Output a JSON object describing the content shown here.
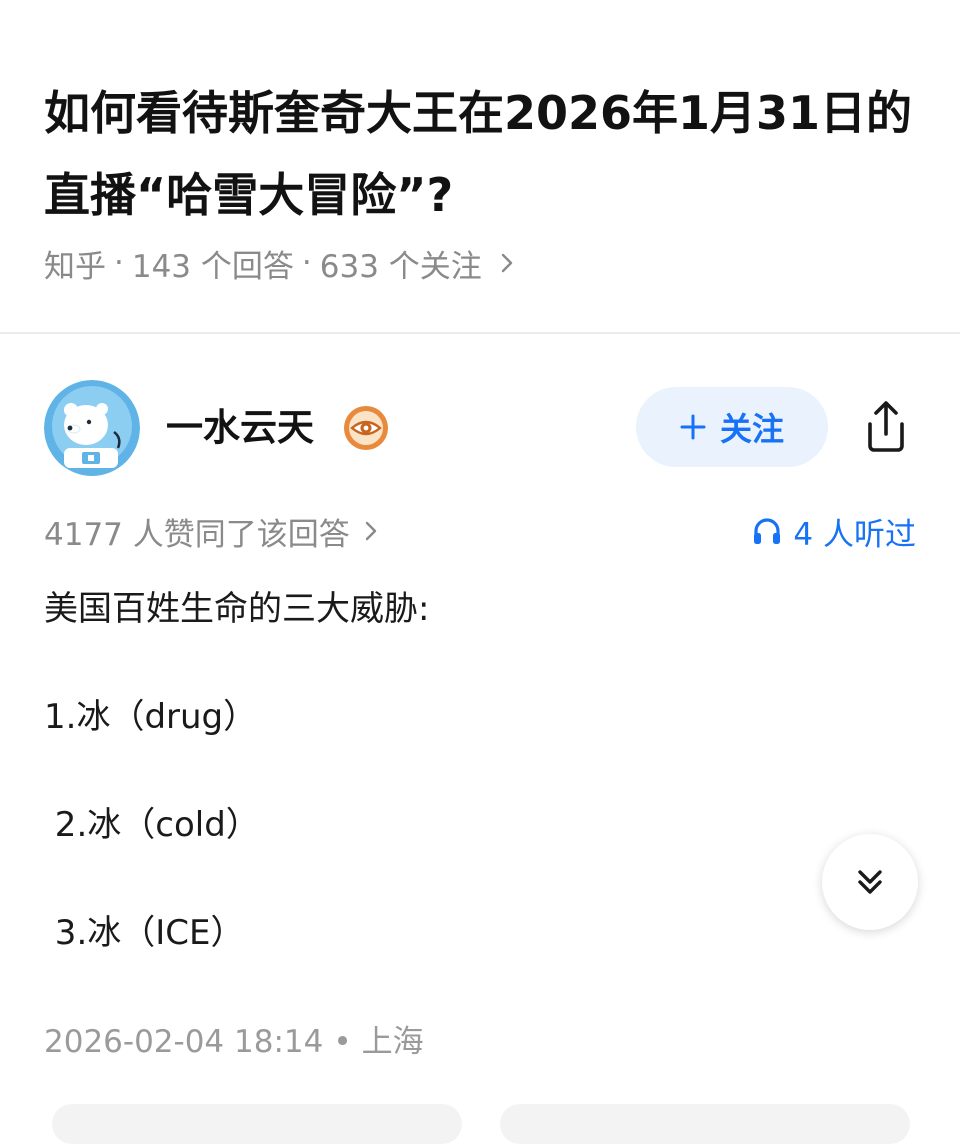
{
  "question": {
    "title": "如何看待斯奎奇大王在2026年1月31日的直播“哈雪大冒险”?",
    "source": "知乎",
    "separator": "·",
    "answer_count": "143 个回答",
    "follower_count": "633 个关注"
  },
  "author": {
    "name": "一水云天",
    "avatar_icon": "polar-bear-astronaut-avatar",
    "badge_icon": "eye-badge-icon"
  },
  "follow_button": {
    "label": "关注",
    "icon": "plus-icon"
  },
  "share_button": {
    "icon": "share-icon"
  },
  "stats": {
    "upvotes": "4177 人赞同了该回答",
    "listeners": "4 人听过",
    "listen_icon": "headphones-icon"
  },
  "answer": {
    "lines": [
      "美国百姓生命的三大威胁:",
      "1.冰（drug）",
      " 2.冰（cold）",
      " 3.冰（ICE）"
    ]
  },
  "footer": {
    "date": "2026-02-04 18:14",
    "dot": "•",
    "location": "上海"
  },
  "colors": {
    "accent": "#1772f6",
    "follow_bg": "#eaf2fd",
    "meta_text": "#8a8a8a",
    "divider": "#ebebeb"
  }
}
